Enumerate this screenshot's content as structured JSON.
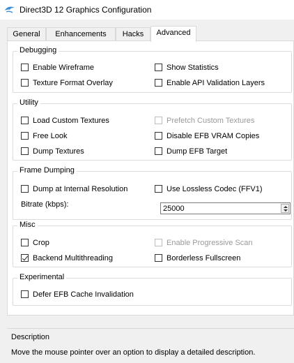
{
  "window": {
    "title": "Direct3D 12 Graphics Configuration",
    "icon": "dolphin-icon"
  },
  "tabs": [
    {
      "label": "General",
      "active": false
    },
    {
      "label": "Enhancements",
      "active": false
    },
    {
      "label": "Hacks",
      "active": false
    },
    {
      "label": "Advanced",
      "active": true
    }
  ],
  "debugging": {
    "title": "Debugging",
    "enable_wireframe": {
      "label": "Enable Wireframe",
      "checked": false
    },
    "show_statistics": {
      "label": "Show Statistics",
      "checked": false
    },
    "texture_format_overlay": {
      "label": "Texture Format Overlay",
      "checked": false
    },
    "enable_api_validation": {
      "label": "Enable API Validation Layers",
      "checked": false
    }
  },
  "utility": {
    "title": "Utility",
    "load_custom_textures": {
      "label": "Load Custom Textures",
      "checked": false
    },
    "prefetch_custom_textures": {
      "label": "Prefetch Custom Textures",
      "checked": false,
      "disabled": true
    },
    "free_look": {
      "label": "Free Look",
      "checked": false
    },
    "disable_efb_vram_copies": {
      "label": "Disable EFB VRAM Copies",
      "checked": false
    },
    "dump_textures": {
      "label": "Dump Textures",
      "checked": false
    },
    "dump_efb_target": {
      "label": "Dump EFB Target",
      "checked": false
    }
  },
  "frame_dumping": {
    "title": "Frame Dumping",
    "dump_internal_resolution": {
      "label": "Dump at Internal Resolution",
      "checked": false
    },
    "lossless_codec": {
      "label": "Use Lossless Codec (FFV1)",
      "checked": false
    },
    "bitrate_label": "Bitrate (kbps):",
    "bitrate_value": "25000"
  },
  "misc": {
    "title": "Misc",
    "crop": {
      "label": "Crop",
      "checked": false
    },
    "enable_progressive_scan": {
      "label": "Enable Progressive Scan",
      "checked": false,
      "disabled": true
    },
    "backend_multithreading": {
      "label": "Backend Multithreading",
      "checked": true
    },
    "borderless_fullscreen": {
      "label": "Borderless Fullscreen",
      "checked": false
    }
  },
  "experimental": {
    "title": "Experimental",
    "defer_efb_cache_invalidation": {
      "label": "Defer EFB Cache Invalidation",
      "checked": false
    }
  },
  "description": {
    "title": "Description",
    "text": "Move the mouse pointer over an option to display a detailed description."
  }
}
